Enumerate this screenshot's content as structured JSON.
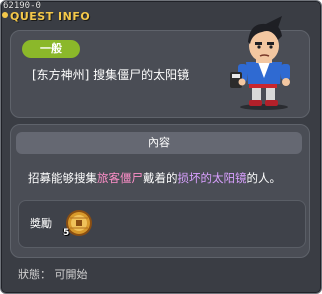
{
  "window": {
    "quest_id": "62190-0",
    "title": "QUEST INFO"
  },
  "quest": {
    "category": "一般",
    "name": "[东方神州] 搜集僵尸的太阳镜"
  },
  "content": {
    "header": "內容",
    "description_parts": [
      {
        "text": "招募能够搜集",
        "style": "normal"
      },
      {
        "text": "旅客僵尸",
        "style": "pink"
      },
      {
        "text": "戴着的",
        "style": "normal"
      },
      {
        "text": "损坏的太阳镜",
        "style": "violet"
      },
      {
        "text": "的人。",
        "style": "normal"
      }
    ]
  },
  "reward": {
    "label": "獎勵",
    "item_icon": "coin-icon",
    "quantity": "5"
  },
  "status": {
    "text": "狀態： 可開始"
  },
  "colors": {
    "title": "#f4c84a",
    "badge": "#8bb82a",
    "highlight_pink": "#ff8fc9",
    "highlight_violet": "#d9a0ff",
    "panel": "#4a4d55",
    "window": "#3a3d44"
  }
}
